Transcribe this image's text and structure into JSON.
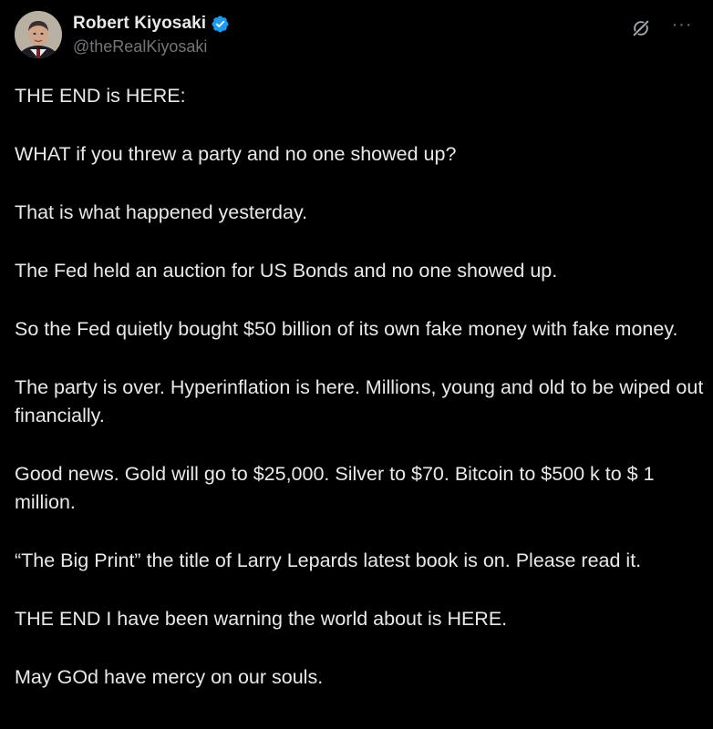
{
  "author": {
    "display_name": "Robert Kiyosaki",
    "handle": "@theRealKiyosaki",
    "verified": true,
    "verified_color": "#1d9bf0"
  },
  "icons": {
    "avatar": "profile-photo",
    "verified": "verified-badge-icon",
    "grok": "grok-icon",
    "more": "more-options-icon"
  },
  "more_label": "···",
  "tweet": {
    "paragraphs": [
      "THE END is HERE:",
      "WHAT if you threw a party and no one showed up?",
      "That is what happened yesterday.",
      "The Fed held an auction for US Bonds and no one showed up.",
      "So the Fed quietly bought $50 billion of its own fake money with fake money.",
      "The party is over.  Hyperinflation is here.  Millions, young and old to be wiped out financially.",
      "Good news.  Gold will go to $25,000.  Silver to $70.  Bitcoin to $500 k to $ 1 million.",
      "“The Big Print” the title of Larry Lepards latest book is on. Please read it.",
      "THE END I have been warning the world about is HERE.",
      "May GOd have mercy on our souls."
    ]
  },
  "colors": {
    "background": "#000000",
    "text": "#e7e9ea",
    "secondary": "#71767b"
  }
}
